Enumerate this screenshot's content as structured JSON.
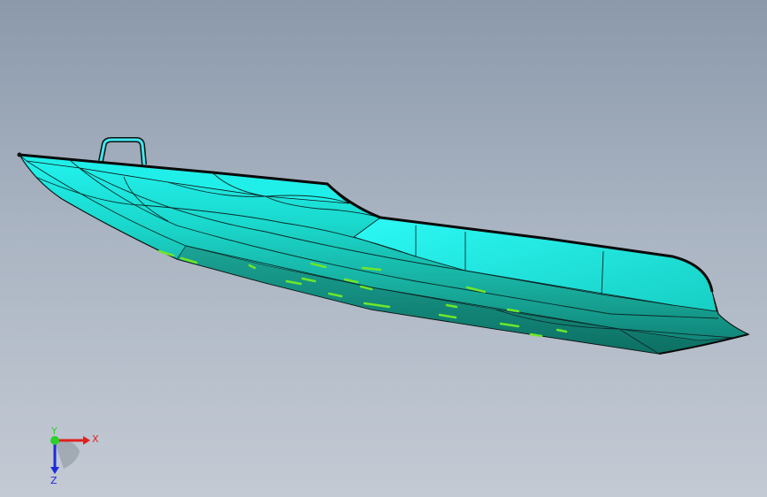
{
  "colors": {
    "hull_top": "#1ef2ee",
    "hull_mid": "#19c9bb",
    "hull_low": "#138a7d",
    "edge": "#111111",
    "decal": "#6ee62a",
    "axis_x": "#e0201e",
    "axis_y": "#2bd02b",
    "axis_z": "#1c2bd8"
  },
  "icons": {
    "triad": "view-orientation-triad-icon"
  },
  "triad": {
    "x_label": "X",
    "y_label": "Y",
    "z_label": "Z"
  }
}
